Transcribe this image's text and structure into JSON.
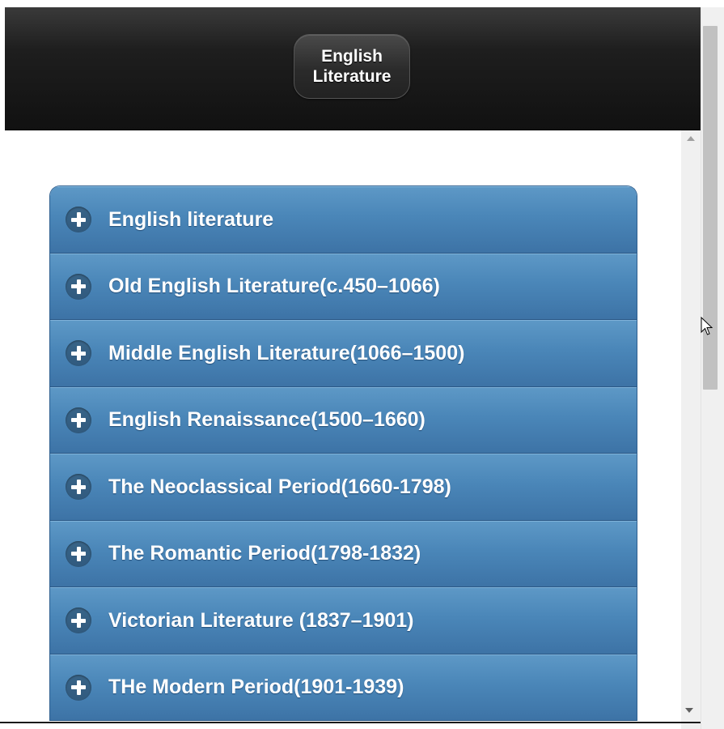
{
  "header": {
    "title": "English Literature"
  },
  "accordion": {
    "items": [
      {
        "label": "English literature"
      },
      {
        "label": "Old English Literature(c.450–1066)"
      },
      {
        "label": "Middle English Literature(1066–1500)"
      },
      {
        "label": "English Renaissance(1500–1660)"
      },
      {
        "label": "The Neoclassical Period(1660-1798)"
      },
      {
        "label": "The Romantic Period(1798-1832)"
      },
      {
        "label": "Victorian Literature (1837–1901)"
      },
      {
        "label": "THe Modern Period(1901-1939)"
      }
    ],
    "expand_icon": "plus-icon"
  },
  "colors": {
    "header_bg": "#111111",
    "accordion_bg": "#4a86b8",
    "text": "#ffffff"
  }
}
